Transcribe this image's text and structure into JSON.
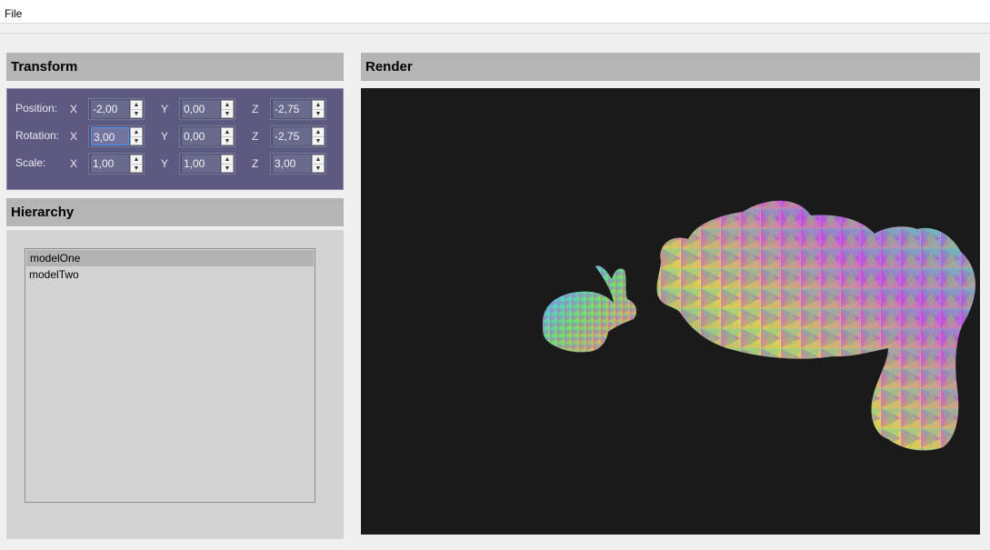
{
  "menubar": {
    "file_label": "File"
  },
  "transform": {
    "title": "Transform",
    "rows": [
      {
        "label": "Position:",
        "x_axis": "X",
        "y_axis": "Y",
        "z_axis": "Z",
        "x": "-2,00",
        "y": "0,00",
        "z": "-2,75"
      },
      {
        "label": "Rotation:",
        "x_axis": "X",
        "y_axis": "Y",
        "z_axis": "Z",
        "x": "3,00",
        "y": "0,00",
        "z": "-2,75"
      },
      {
        "label": "Scale:",
        "x_axis": "X",
        "y_axis": "Y",
        "z_axis": "Z",
        "x": "1,00",
        "y": "1,00",
        "z": "3,00"
      }
    ]
  },
  "hierarchy": {
    "title": "Hierarchy",
    "items": [
      "modelOne",
      "modelTwo"
    ],
    "selected": "modelOne"
  },
  "render": {
    "title": "Render",
    "background": "#1a1a1a",
    "models": [
      "bunny-small",
      "bunny-large"
    ]
  }
}
